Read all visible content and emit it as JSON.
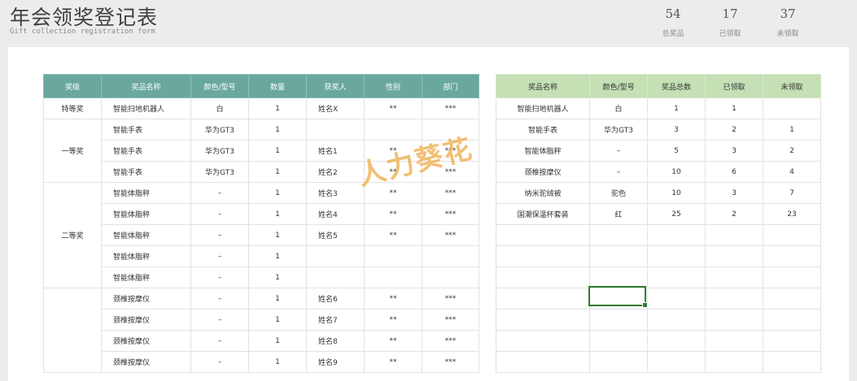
{
  "header": {
    "title": "年会领奖登记表",
    "subtitle": "Gift collection registration form",
    "stats": [
      {
        "value": "54",
        "label": "总奖品"
      },
      {
        "value": "17",
        "label": "已领取"
      },
      {
        "value": "37",
        "label": "未领取"
      }
    ]
  },
  "left_table": {
    "columns": [
      "奖级",
      "奖品名称",
      "颜色/型号",
      "数量",
      "获奖人",
      "性别",
      "部门"
    ],
    "levels": [
      "特等奖",
      "一等奖",
      "二等奖"
    ],
    "rows": [
      {
        "prize": "智能扫地机器人",
        "model": "白",
        "qty": "1",
        "winner": "姓名X",
        "gender": "**",
        "dept": "***"
      },
      {
        "prize": "智能手表",
        "model": "华为GT3",
        "qty": "1",
        "winner": "",
        "gender": "",
        "dept": ""
      },
      {
        "prize": "智能手表",
        "model": "华为GT3",
        "qty": "1",
        "winner": "姓名1",
        "gender": "**",
        "dept": "***"
      },
      {
        "prize": "智能手表",
        "model": "华为GT3",
        "qty": "1",
        "winner": "姓名2",
        "gender": "**",
        "dept": "***"
      },
      {
        "prize": "智能体脂秤",
        "model": "–",
        "qty": "1",
        "winner": "姓名3",
        "gender": "**",
        "dept": "***"
      },
      {
        "prize": "智能体脂秤",
        "model": "–",
        "qty": "1",
        "winner": "姓名4",
        "gender": "**",
        "dept": "***"
      },
      {
        "prize": "智能体脂秤",
        "model": "–",
        "qty": "1",
        "winner": "姓名5",
        "gender": "**",
        "dept": "***"
      },
      {
        "prize": "智能体脂秤",
        "model": "–",
        "qty": "1",
        "winner": "",
        "gender": "",
        "dept": ""
      },
      {
        "prize": "智能体脂秤",
        "model": "–",
        "qty": "1",
        "winner": "",
        "gender": "",
        "dept": ""
      },
      {
        "prize": "颈椎按摩仪",
        "model": "–",
        "qty": "1",
        "winner": "姓名6",
        "gender": "**",
        "dept": "***"
      },
      {
        "prize": "颈椎按摩仪",
        "model": "–",
        "qty": "1",
        "winner": "姓名7",
        "gender": "**",
        "dept": "***"
      },
      {
        "prize": "颈椎按摩仪",
        "model": "–",
        "qty": "1",
        "winner": "姓名8",
        "gender": "**",
        "dept": "***"
      },
      {
        "prize": "颈椎按摩仪",
        "model": "–",
        "qty": "1",
        "winner": "姓名9",
        "gender": "**",
        "dept": "***"
      }
    ]
  },
  "right_table": {
    "columns": [
      "奖品名称",
      "颜色/型号",
      "奖品总数",
      "已领取",
      "未领取"
    ],
    "rows": [
      {
        "prize": "智能扫地机器人",
        "model": "白",
        "total": "1",
        "claimed": "1",
        "unclaimed": ""
      },
      {
        "prize": "智能手表",
        "model": "华为GT3",
        "total": "3",
        "claimed": "2",
        "unclaimed": "1"
      },
      {
        "prize": "智能体脂秤",
        "model": "–",
        "total": "5",
        "claimed": "3",
        "unclaimed": "2"
      },
      {
        "prize": "颈椎按摩仪",
        "model": "–",
        "total": "10",
        "claimed": "6",
        "unclaimed": "4"
      },
      {
        "prize": "纳米驼绒被",
        "model": "驼色",
        "total": "10",
        "claimed": "3",
        "unclaimed": "7"
      },
      {
        "prize": "国潮保温杯套装",
        "model": "红",
        "total": "25",
        "claimed": "2",
        "unclaimed": "23"
      },
      {
        "prize": "",
        "model": "",
        "total": "",
        "claimed": "",
        "unclaimed": ""
      },
      {
        "prize": "",
        "model": "",
        "total": "",
        "claimed": "",
        "unclaimed": ""
      },
      {
        "prize": "",
        "model": "",
        "total": "",
        "claimed": "",
        "unclaimed": ""
      },
      {
        "prize": "",
        "model": "",
        "total": "",
        "claimed": "",
        "unclaimed": ""
      },
      {
        "prize": "",
        "model": "",
        "total": "",
        "claimed": "",
        "unclaimed": ""
      },
      {
        "prize": "",
        "model": "",
        "total": "",
        "claimed": "",
        "unclaimed": ""
      },
      {
        "prize": "",
        "model": "",
        "total": "",
        "claimed": "",
        "unclaimed": ""
      }
    ]
  },
  "watermark": "人力葵花",
  "colors": {
    "left_header": "#6aa89e",
    "right_header": "#c4e0b4",
    "selection": "#2f7d2f",
    "watermark": "#f0b45a"
  }
}
